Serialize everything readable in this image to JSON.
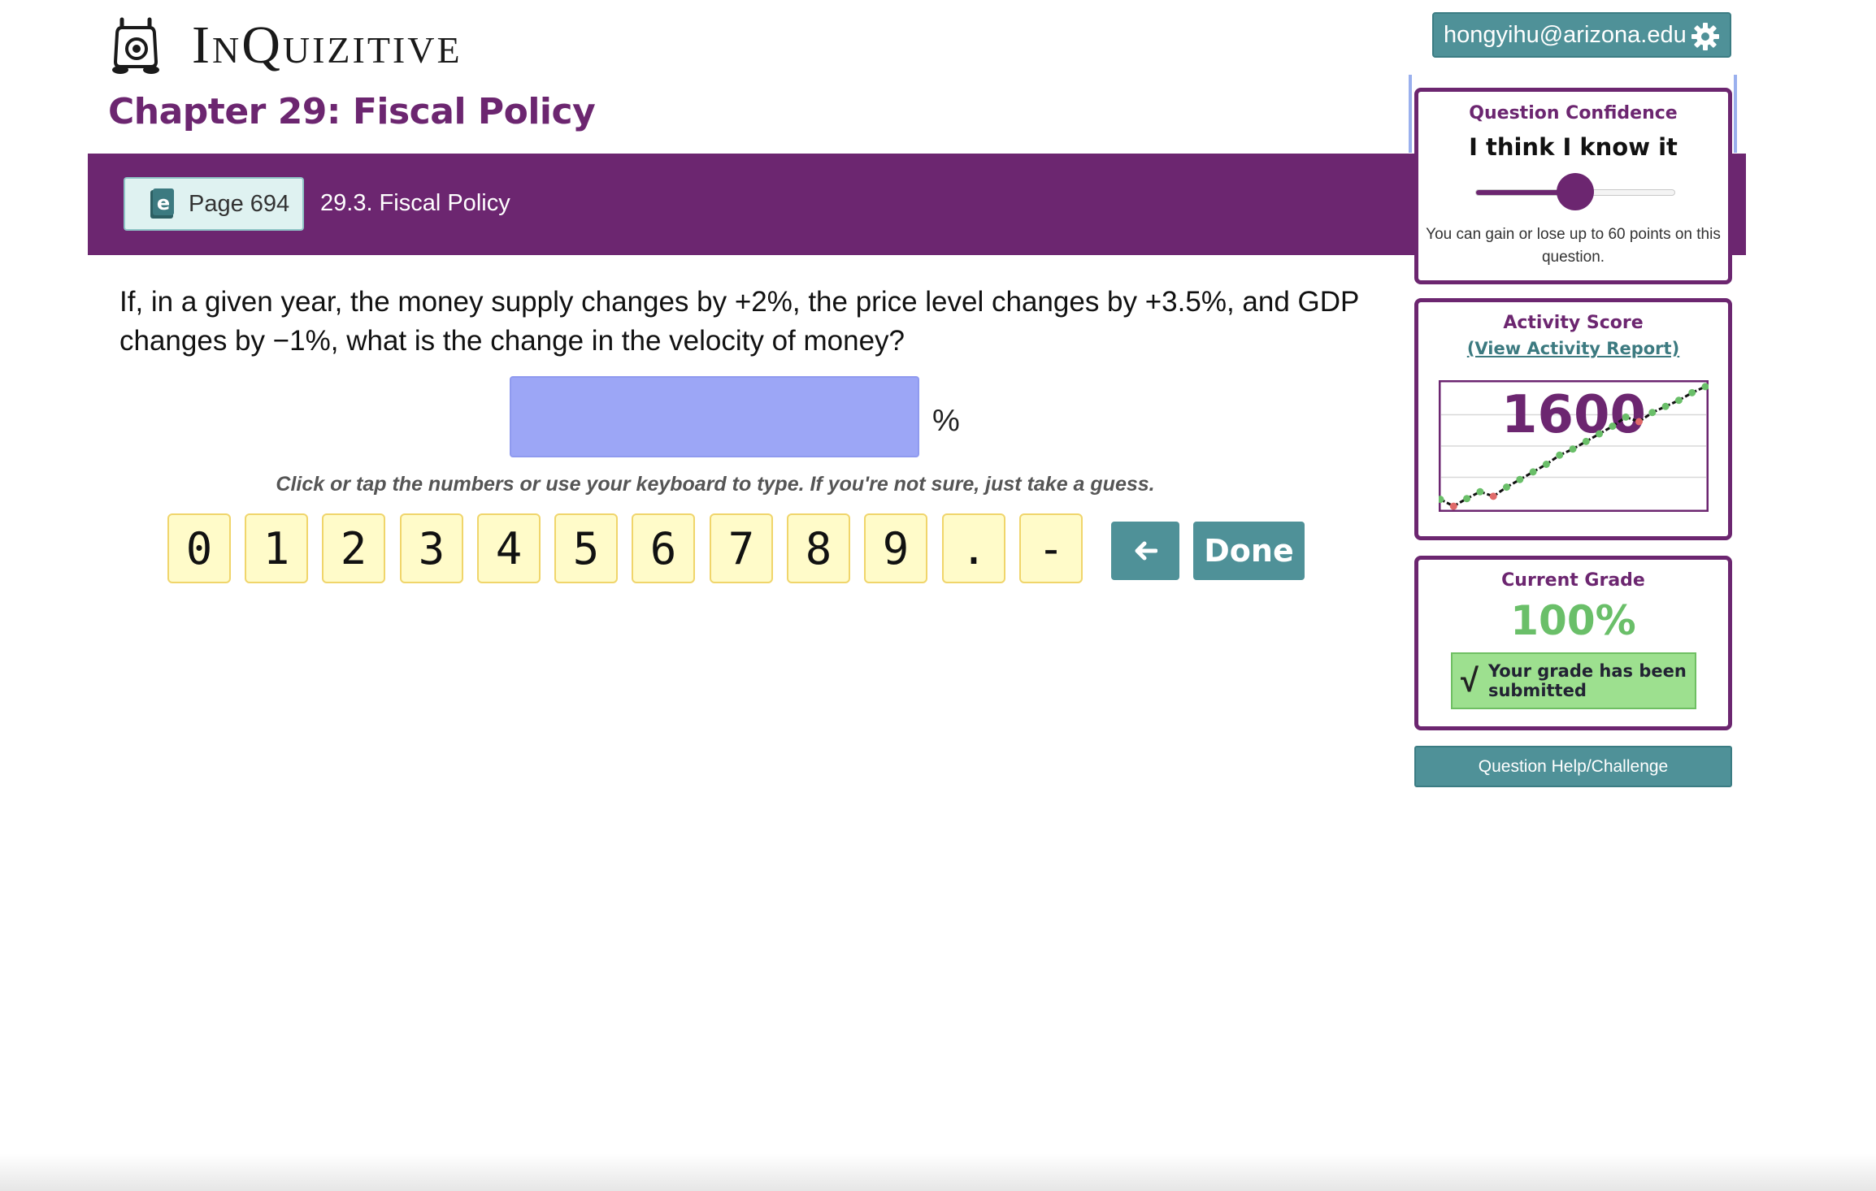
{
  "app": {
    "logo_text": "InQuizitive",
    "chapter_title": "Chapter 29: Fiscal Policy"
  },
  "user": {
    "email": "hongyihu@arizona.edu"
  },
  "section": {
    "page_label": "Page 694",
    "section_label": "29.3. Fiscal Policy"
  },
  "question": {
    "text": "If, in a given year, the money supply changes by +2%, the price level changes by +3.5%, and GDP changes by −1%, what is the change in the velocity of money?",
    "answer_value": "",
    "unit": "%",
    "instruction": "Click or tap the numbers or use your keyboard to type. If you're not sure, just take a guess."
  },
  "keypad": {
    "keys": [
      "0",
      "1",
      "2",
      "3",
      "4",
      "5",
      "6",
      "7",
      "8",
      "9",
      ".",
      "-"
    ],
    "done_label": "Done"
  },
  "confidence": {
    "title": "Question Confidence",
    "value_label": "I think I know it",
    "level_fraction": 0.5,
    "note": "You can gain or lose up to 60 points on this question."
  },
  "activity": {
    "title": "Activity Score",
    "report_link": "(View Activity Report)",
    "score": "1600",
    "colors": {
      "correct": "#6abf69",
      "incorrect": "#e06a6a",
      "line": "#111111"
    },
    "chart_data": {
      "type": "line",
      "points": [
        {
          "x": 0,
          "y": 10,
          "r": "correct"
        },
        {
          "x": 1,
          "y": 1,
          "r": "incorrect"
        },
        {
          "x": 2,
          "y": 11,
          "r": "correct"
        },
        {
          "x": 3,
          "y": 20,
          "r": "correct"
        },
        {
          "x": 4,
          "y": 14,
          "r": "incorrect"
        },
        {
          "x": 5,
          "y": 26,
          "r": "correct"
        },
        {
          "x": 6,
          "y": 36,
          "r": "correct"
        },
        {
          "x": 7,
          "y": 46,
          "r": "correct"
        },
        {
          "x": 8,
          "y": 56,
          "r": "correct"
        },
        {
          "x": 9,
          "y": 68,
          "r": "correct"
        },
        {
          "x": 10,
          "y": 76,
          "r": "correct"
        },
        {
          "x": 11,
          "y": 86,
          "r": "correct"
        },
        {
          "x": 12,
          "y": 96,
          "r": "correct"
        },
        {
          "x": 13,
          "y": 106,
          "r": "correct"
        },
        {
          "x": 14,
          "y": 118,
          "r": "correct"
        },
        {
          "x": 15,
          "y": 112,
          "r": "incorrect"
        },
        {
          "x": 16,
          "y": 124,
          "r": "correct"
        },
        {
          "x": 17,
          "y": 132,
          "r": "correct"
        },
        {
          "x": 18,
          "y": 140,
          "r": "correct"
        },
        {
          "x": 19,
          "y": 150,
          "r": "correct"
        },
        {
          "x": 20,
          "y": 158,
          "r": "correct"
        }
      ],
      "xlim": [
        0,
        20
      ],
      "ylim": [
        0,
        160
      ],
      "grid": true
    }
  },
  "grade": {
    "title": "Current Grade",
    "value": "100%",
    "submitted_text": "Your grade has been submitted",
    "check_symbol": "√"
  },
  "help": {
    "label": "Question Help/Challenge"
  }
}
